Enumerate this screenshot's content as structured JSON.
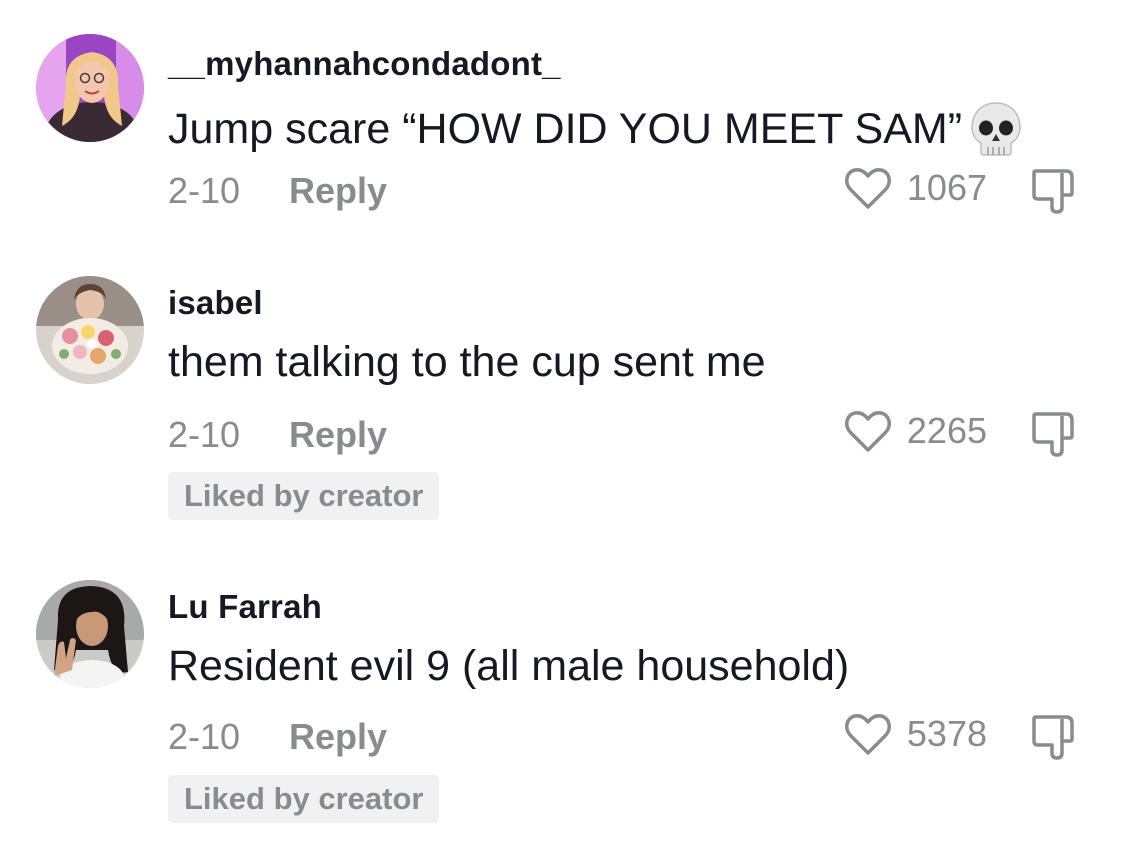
{
  "comments": [
    {
      "username": "__myhannahcondadont_",
      "text": "Jump scare “HOW DID YOU MEET SAM”",
      "emoji": "skull-emoji",
      "date": "2-10",
      "reply_label": "Reply",
      "likes": "1067",
      "badge": ""
    },
    {
      "username": "isabel",
      "text": "them talking to the cup sent me",
      "date": "2-10",
      "reply_label": "Reply",
      "likes": "2265",
      "badge": "Liked by creator"
    },
    {
      "username": "Lu Farrah",
      "text": "Resident evil 9 (all male household)",
      "date": "2-10",
      "reply_label": "Reply",
      "likes": "5378",
      "badge": "Liked by creator"
    }
  ],
  "icons": {
    "like": "heart-outline-icon",
    "dislike": "thumbs-down-icon"
  },
  "colors": {
    "text_primary": "#161823",
    "text_secondary": "#8a8b91",
    "badge_bg": "#f1f1f2"
  }
}
